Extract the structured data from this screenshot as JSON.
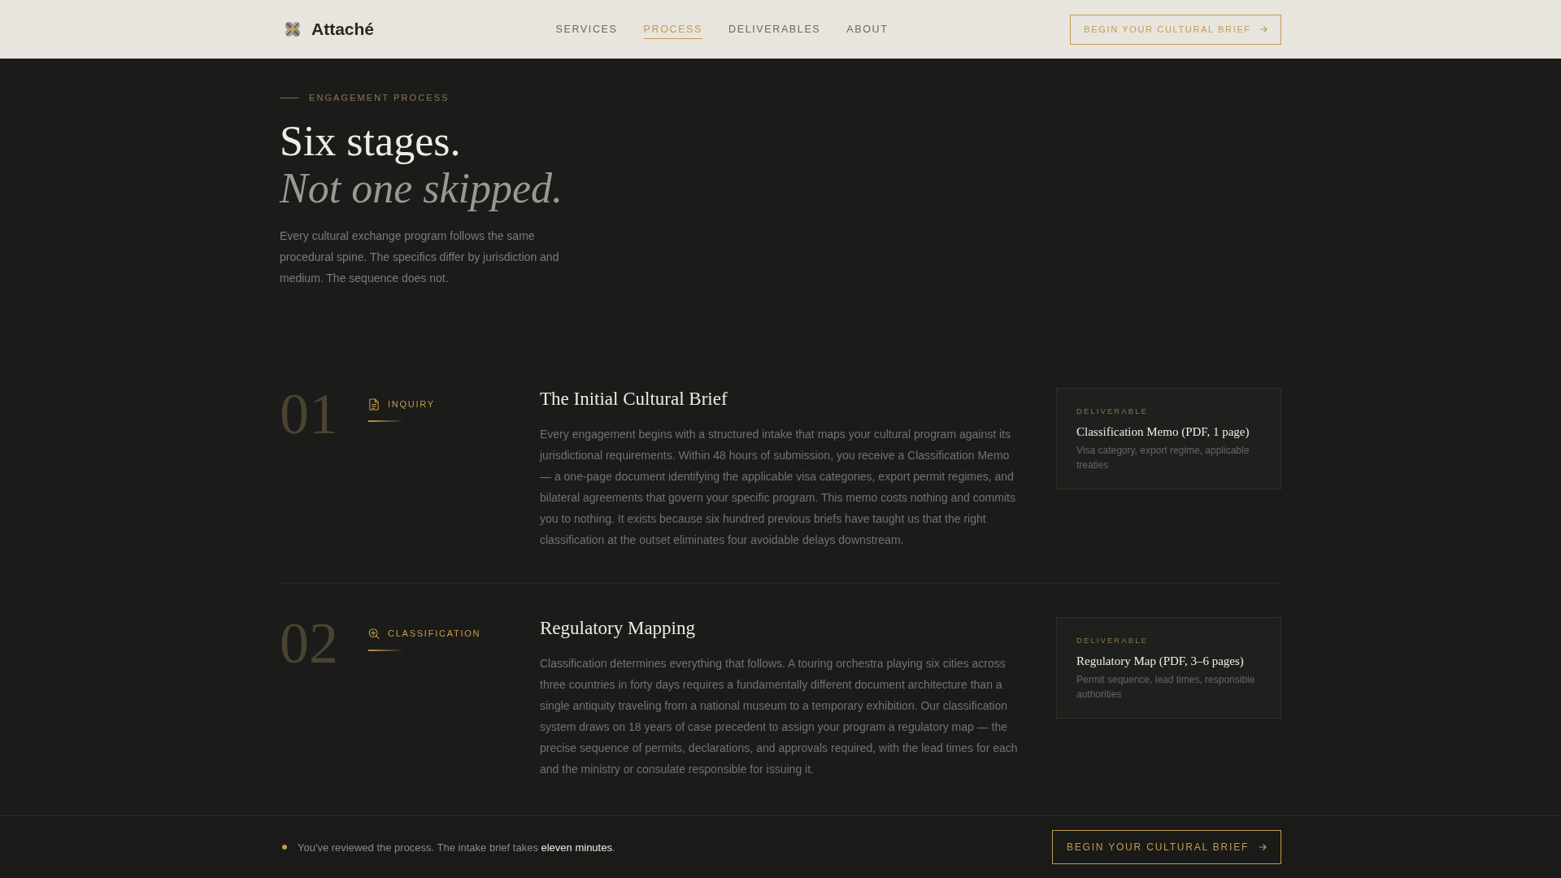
{
  "header": {
    "brand": "Attaché",
    "nav": [
      {
        "label": "SERVICES",
        "selected": false
      },
      {
        "label": "PROCESS",
        "selected": true
      },
      {
        "label": "DELIVERABLES",
        "selected": false
      },
      {
        "label": "ABOUT",
        "selected": false
      }
    ],
    "cta": "BEGIN YOUR CULTURAL BRIEF"
  },
  "hero": {
    "eyebrow": "ENGAGEMENT PROCESS",
    "title": "Six stages.",
    "title_italic": "Not one skipped.",
    "intro": "Every cultural exchange program follows the same procedural spine. The specifics differ by jurisdiction and medium. The sequence does not."
  },
  "stages": [
    {
      "number": "01",
      "label": "INQUIRY",
      "title": "The Initial Cultural Brief",
      "body": "Every engagement begins with a structured intake that maps your cultural program against its jurisdictional requirements. Within 48 hours of submission, you receive a Classification Memo — a one-page document identifying the applicable visa categories, export permit regimes, and bilateral agreements that govern your specific program. This memo costs nothing and commits you to nothing. It exists because six hundred previous briefs have taught us that the right classification at the outset eliminates four avoidable delays downstream.",
      "deliverable": {
        "eyebrow": "DELIVERABLE",
        "title": "Classification Memo (PDF, 1 page)",
        "description": "Visa category, export regime, applicable treaties"
      }
    },
    {
      "number": "02",
      "label": "CLASSIFICATION",
      "title": "Regulatory Mapping",
      "body": "Classification determines everything that follows. A touring orchestra playing six cities across three countries in forty days requires a fundamentally different document architecture than a single antiquity traveling from a national museum to a temporary exhibition. Our classification system draws on 18 years of case precedent to assign your program a regulatory map — the precise sequence of permits, declarations, and approvals required, with the lead times for each and the ministry or consulate responsible for issuing it.",
      "deliverable": {
        "eyebrow": "DELIVERABLE",
        "title": "Regulatory Map (PDF, 3–6 pages)",
        "description": "Permit sequence, lead times, responsible authorities"
      }
    }
  ],
  "bottom_bar": {
    "message": "You've reviewed the process. The intake brief takes **eleven minutes**.",
    "cta": "BEGIN YOUR CULTURAL BRIEF"
  }
}
